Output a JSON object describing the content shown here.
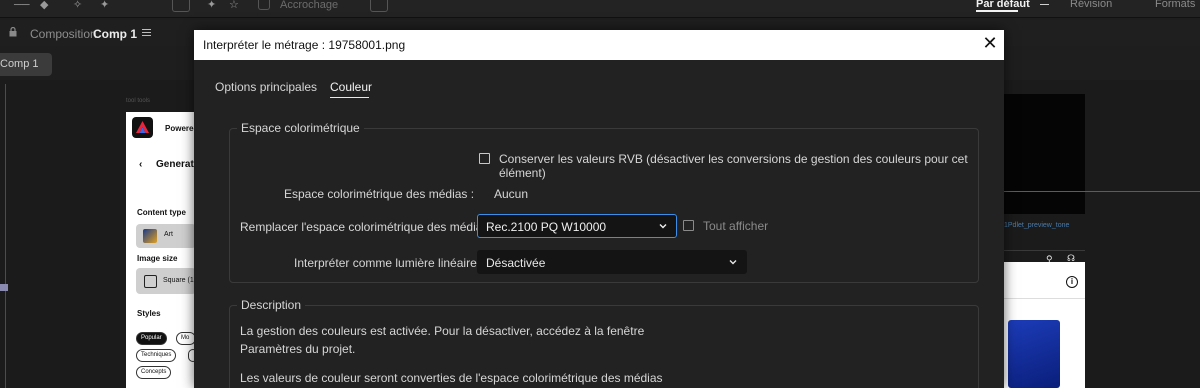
{
  "app": {
    "workspaces": {
      "default": "Par défaut",
      "review": "Révision",
      "formats": "Formats"
    },
    "toolbar": {
      "snapping_label": "Accrochage"
    },
    "panel": {
      "prefix": "Composition",
      "name": "Comp 1"
    },
    "viewer_tab": "Comp 1",
    "preview_left": {
      "brand": "Powered",
      "heading": "Generat",
      "back_glyph": "‹",
      "content_type_label": "Content type",
      "art_label": "Art",
      "image_size_label": "Image size",
      "square_label": "Square (1",
      "styles_label": "Styles",
      "chips": {
        "popular": "Popular",
        "mo": "Mo",
        "technique": "Techniques",
        "concepts": "Concepts"
      },
      "top_labels": "tool    tools"
    },
    "preview_right": {
      "filename": "1Pdlet_preview_tone",
      "info_glyph": "i"
    }
  },
  "dialog": {
    "title": "Interpréter le métrage : 19758001.png",
    "close_glyph": "✕",
    "tabs": [
      {
        "label": "Options principales",
        "active": false
      },
      {
        "label": "Couleur",
        "active": true
      }
    ],
    "colorspace_group": {
      "legend": "Espace colorimétrique",
      "preserve_rgb": {
        "label": "Conserver les valeurs RVB (désactiver les conversions de gestion des couleurs pour cet élément)",
        "checked": false
      },
      "media_colorspace": {
        "label": "Espace colorimétrique des médias :",
        "value": "Aucun"
      },
      "override": {
        "label": "Remplacer l'espace colorimétrique des médias :",
        "value": "Rec.2100 PQ W10000",
        "show_all_label": "Tout afficher",
        "show_all_checked": false
      },
      "linear_light": {
        "label": "Interpréter comme lumière linéaire :",
        "value": "Désactivée"
      }
    },
    "description_group": {
      "legend": "Description",
      "lines": [
        "La gestion des couleurs est activée. Pour la désactiver, accédez à la fenêtre",
        "Paramètres du projet.",
        "Les valeurs de couleur seront converties de l'espace colorimétrique des médias"
      ]
    }
  },
  "colors": {
    "accent": "#3b8eea",
    "dialog_bg": "#222222",
    "title_bar": "#ffffff"
  }
}
